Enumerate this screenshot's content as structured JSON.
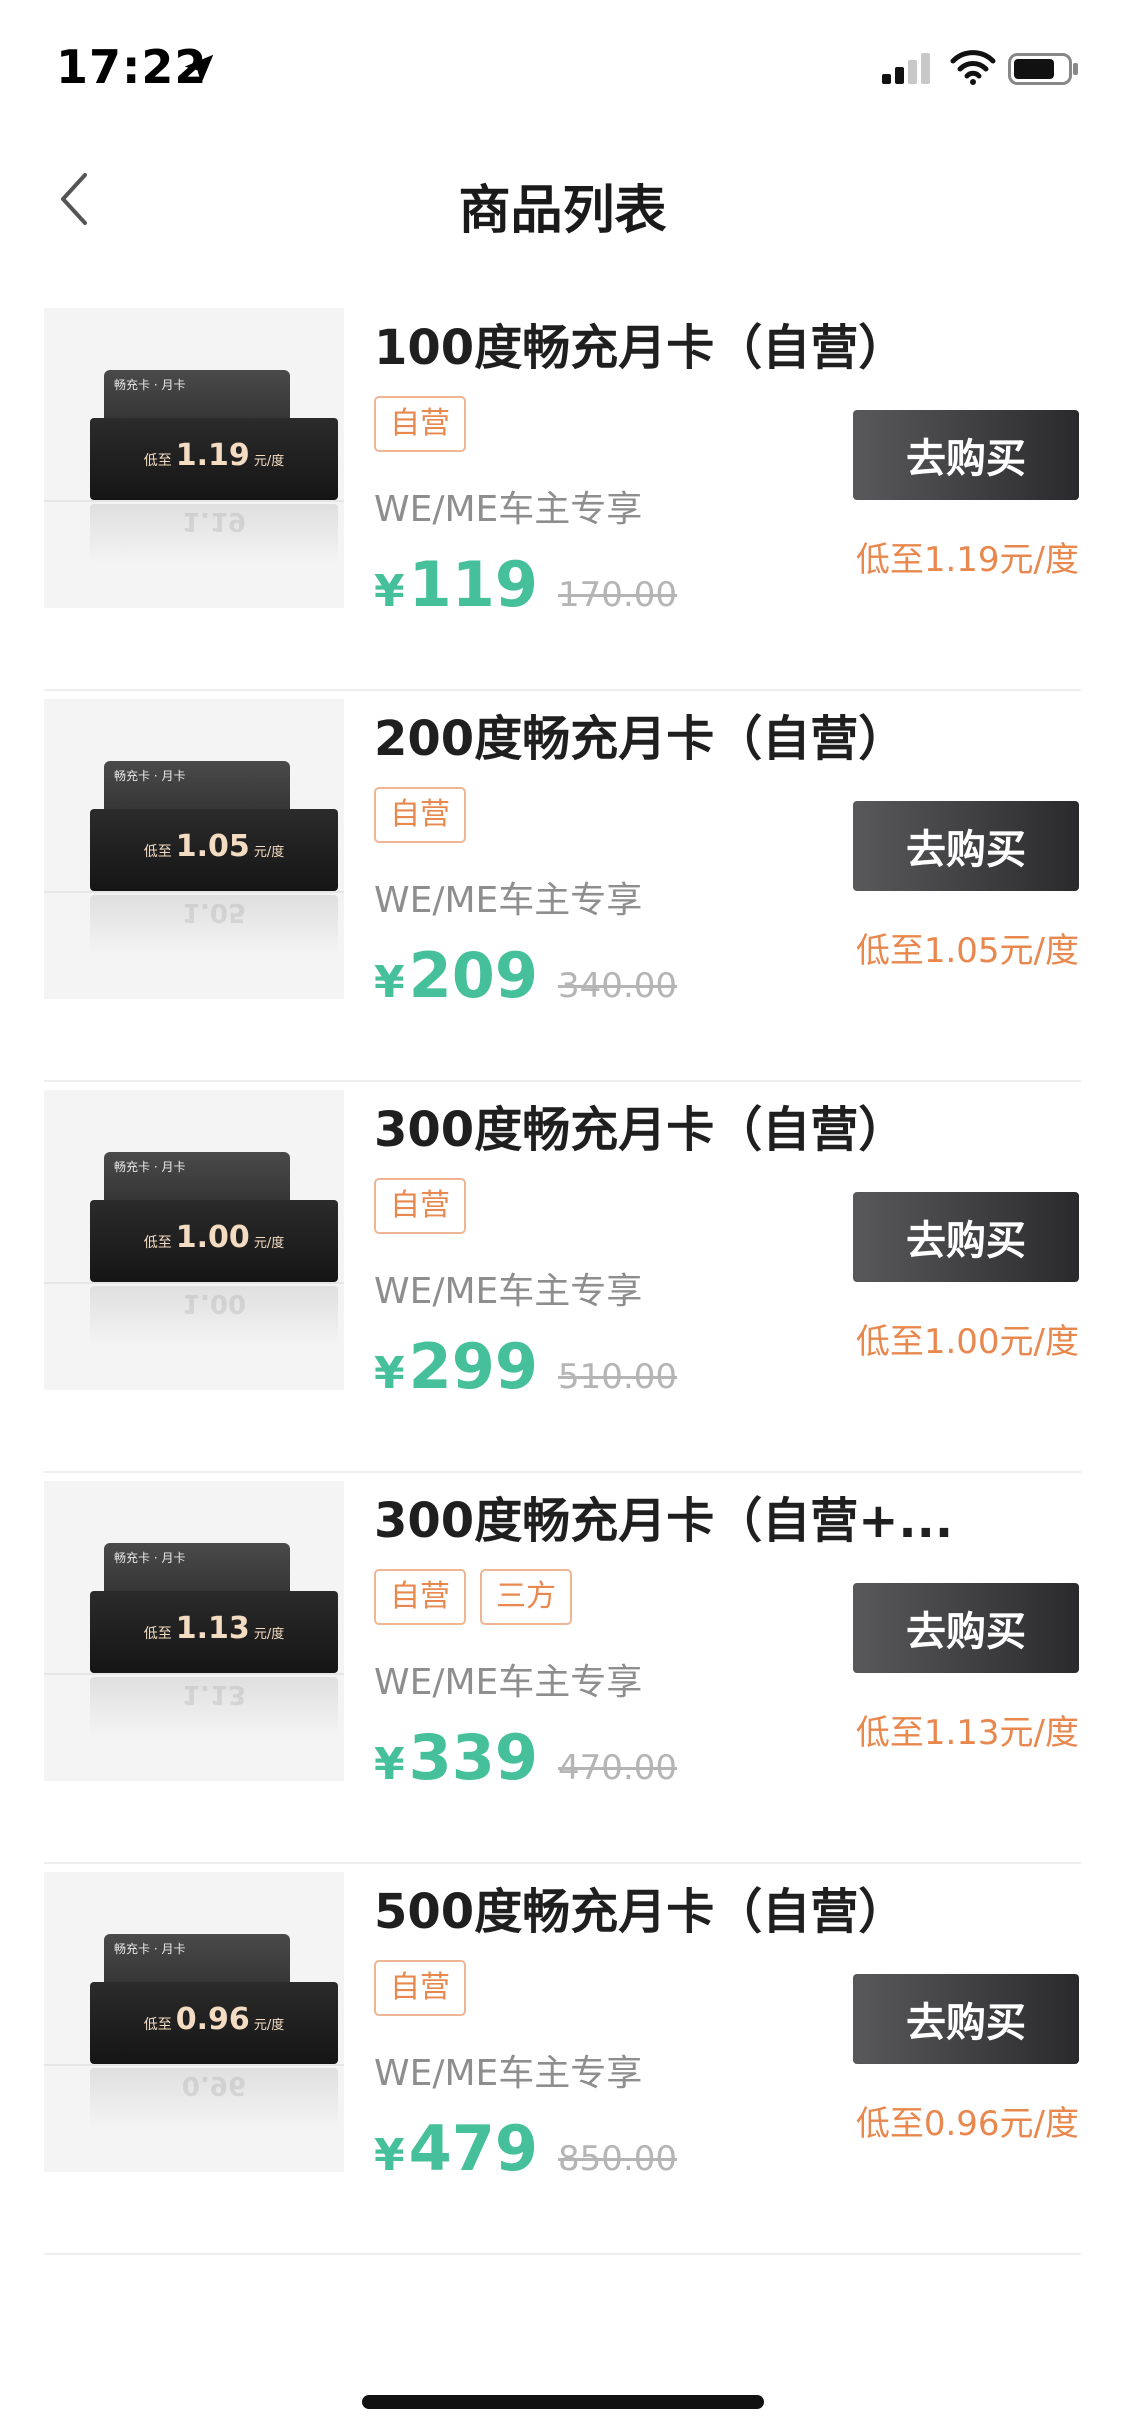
{
  "status_bar": {
    "time": "17:22"
  },
  "nav": {
    "title": "商品列表"
  },
  "products": [
    {
      "title": "100度畅充月卡（自营）",
      "tags": [
        "自营"
      ],
      "desc": "WE/ME车主专享",
      "currency": "¥",
      "price": "119",
      "original_price": "170.00",
      "unit_price": "低至1.19元/度",
      "buy_label": "去购买",
      "card_label": "畅充卡 · 月卡",
      "card_prefix": "低至",
      "card_value": "1.19",
      "card_unit": "元/度"
    },
    {
      "title": "200度畅充月卡（自营）",
      "tags": [
        "自营"
      ],
      "desc": "WE/ME车主专享",
      "currency": "¥",
      "price": "209",
      "original_price": "340.00",
      "unit_price": "低至1.05元/度",
      "buy_label": "去购买",
      "card_label": "畅充卡 · 月卡",
      "card_prefix": "低至",
      "card_value": "1.05",
      "card_unit": "元/度"
    },
    {
      "title": "300度畅充月卡（自营）",
      "tags": [
        "自营"
      ],
      "desc": "WE/ME车主专享",
      "currency": "¥",
      "price": "299",
      "original_price": "510.00",
      "unit_price": "低至1.00元/度",
      "buy_label": "去购买",
      "card_label": "畅充卡 · 月卡",
      "card_prefix": "低至",
      "card_value": "1.00",
      "card_unit": "元/度"
    },
    {
      "title": "300度畅充月卡（自营+...",
      "tags": [
        "自营",
        "三方"
      ],
      "desc": "WE/ME车主专享",
      "currency": "¥",
      "price": "339",
      "original_price": "470.00",
      "unit_price": "低至1.13元/度",
      "buy_label": "去购买",
      "card_label": "畅充卡 · 月卡",
      "card_prefix": "低至",
      "card_value": "1.13",
      "card_unit": "元/度"
    },
    {
      "title": "500度畅充月卡（自营）",
      "tags": [
        "自营"
      ],
      "desc": "WE/ME车主专享",
      "currency": "¥",
      "price": "479",
      "original_price": "850.00",
      "unit_price": "低至0.96元/度",
      "buy_label": "去购买",
      "card_label": "畅充卡 · 月卡",
      "card_prefix": "低至",
      "card_value": "0.96",
      "card_unit": "元/度"
    }
  ],
  "colors": {
    "accent_green": "#45c09a",
    "accent_orange": "#e8884f",
    "button_dark": "#2a2a2c"
  }
}
